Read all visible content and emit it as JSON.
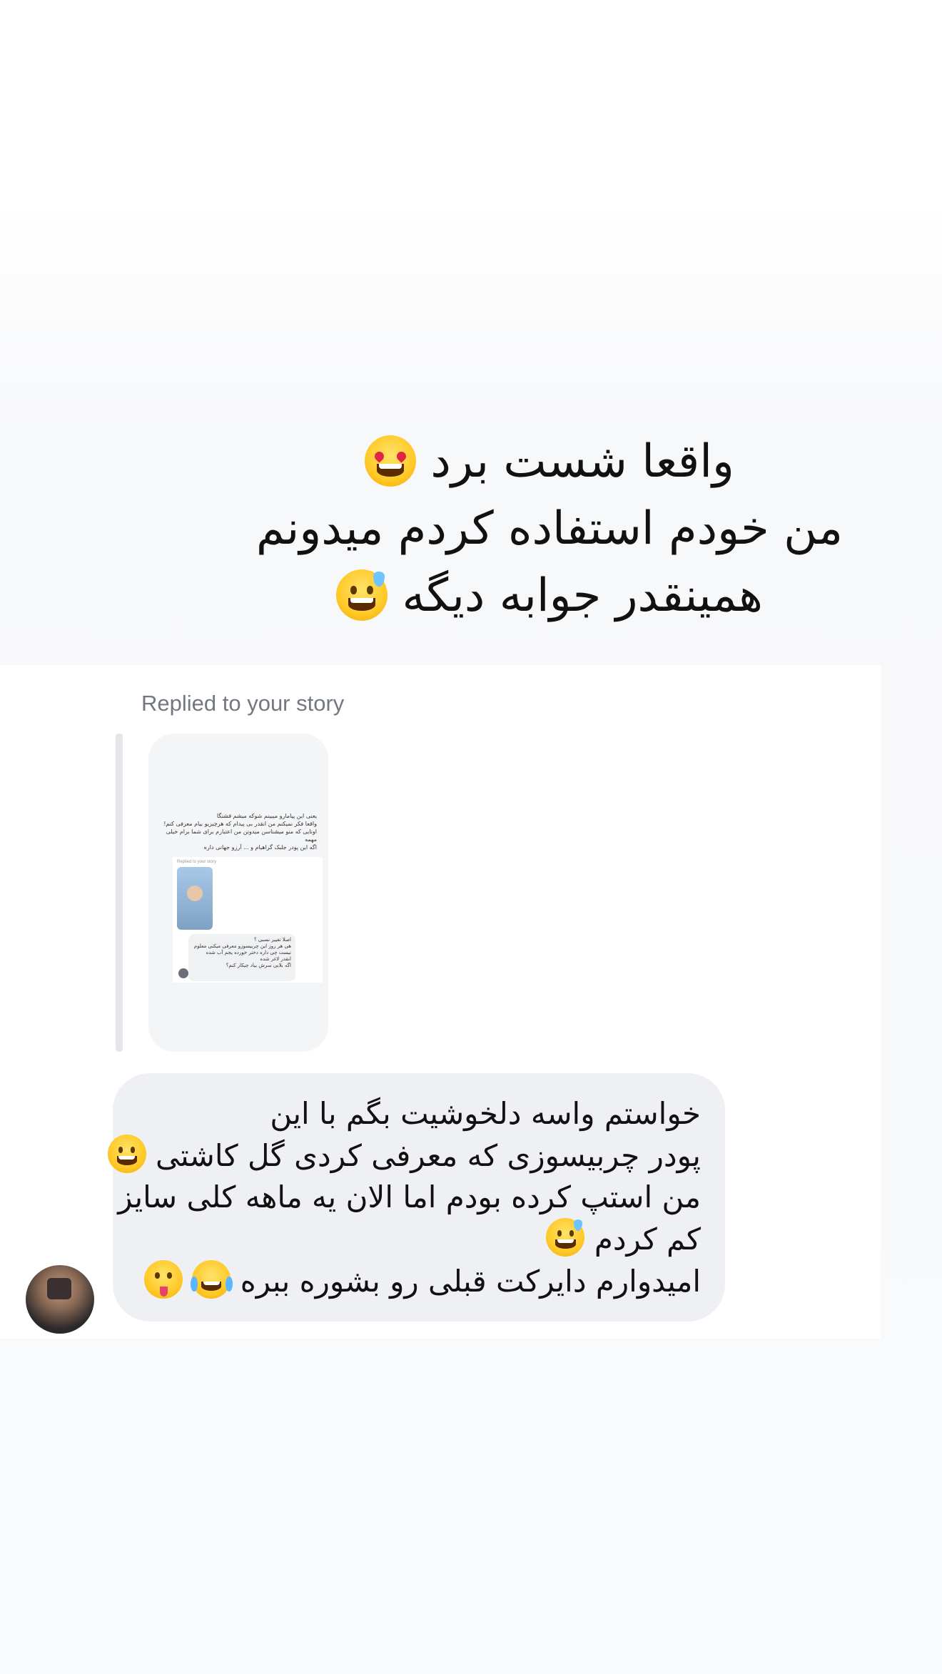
{
  "caption": {
    "line1": "واقعا شست برد",
    "line2": "من خودم استفاده کردم میدونم",
    "line3": "همینقدر جوابه دیگه",
    "line1_emoji": "heart-eyes-emoji",
    "line3_emoji": "grinning-sweat-emoji"
  },
  "story_reply": {
    "replied_label": "Replied to your story",
    "thumbnail": {
      "text_lines": [
        "یعنی این پیامارو میبینم شوکه میشم قشنگا",
        "واقعا فکر نمیکنم من انقدر بی پیدام که هرچیزیو بیام معرفی کنم!",
        "اونایی که منو میشناسن میدونن من اعتبارم برای شما برام خیلی مهمه",
        "اگه این پودر جلبک گراهیام و ... آرزو جهانی داره"
      ],
      "replied_label": "Replied to your story",
      "bubble_lines": [
        "اصلا تغییر نسبی ؟",
        "هی هر روز این چربیسوزو معرفی میکنی معلوم",
        "نیست چی داره دختر خورده یجم آب شده",
        "انقدر لاغر شده",
        "اگه بلایی سرش بیاد چیکار کنم؟"
      ]
    }
  },
  "message": {
    "lines": [
      "خواستم واسه دلخوشیت بگم با این",
      "پودر چربیسوزی که معرفی کردی گل کاشتی",
      "من استپ کرده بودم اما الان یه ماهه کلی سایز",
      "کم کردم",
      "امیدوارم دایرکت قبلی رو بشوره ببره"
    ],
    "emojis": [
      "grinning-emoji",
      "grinning-sweat-emoji",
      "tears-of-joy-emoji",
      "winking-tongue-emoji"
    ]
  },
  "sender": {
    "avatar": "profile-photo"
  }
}
